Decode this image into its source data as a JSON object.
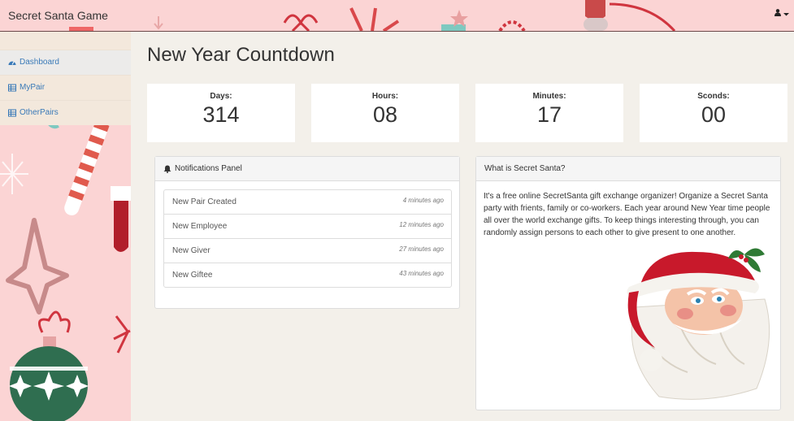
{
  "app": {
    "title": "Secret Santa Game"
  },
  "header": {
    "user_icon": "user-icon",
    "caret_icon": "caret-down-icon"
  },
  "sidebar": {
    "items": [
      {
        "label": "Dashboard",
        "icon": "dashboard-icon",
        "active": true
      },
      {
        "label": "MyPair",
        "icon": "table-icon",
        "active": false
      },
      {
        "label": "OtherPairs",
        "icon": "table-icon",
        "active": false
      }
    ],
    "link_color": "#3a7ab8"
  },
  "main": {
    "title": "New Year Countdown",
    "countdown": [
      {
        "label": "Days:",
        "value": "314"
      },
      {
        "label": "Hours:",
        "value": "08"
      },
      {
        "label": "Minutes:",
        "value": "17"
      },
      {
        "label": "Sconds:",
        "value": "00"
      }
    ],
    "notifications": {
      "title": "Notifications Panel",
      "icon": "bell-icon",
      "items": [
        {
          "label": "New Pair Created",
          "time": "4 minutes ago"
        },
        {
          "label": "New Employee",
          "time": "12 minutes ago"
        },
        {
          "label": "New Giver",
          "time": "27 minutes ago"
        },
        {
          "label": "New Giftee",
          "time": "43 minutes ago"
        }
      ]
    },
    "about": {
      "title": "What is Secret Santa?",
      "text": "It's a free online SecretSanta gift exchange organizer! Organize a Secret Santa party with frients, family or co-workers. Each year around New Year time people all over the world exchange gifts. To keep things interesting through, you can randomly assign persons to each other to give present to one another.",
      "image": "santa-claus-image"
    }
  },
  "colors": {
    "header_bg": "#fbd4d4",
    "page_bg": "#f3f0ea",
    "santa_red": "#c8192b"
  }
}
